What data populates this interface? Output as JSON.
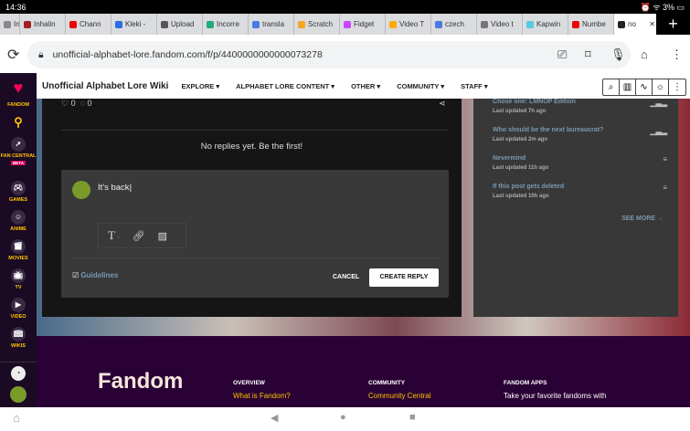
{
  "status": {
    "time": "14:36",
    "battery": "3%"
  },
  "tabs": [
    {
      "label": "Inc",
      "color": "#888"
    },
    {
      "label": "Inhalin",
      "color": "#a02020"
    },
    {
      "label": "Chann",
      "color": "#e00"
    },
    {
      "label": "Kleki -",
      "color": "#2a6de0"
    },
    {
      "label": "Upload",
      "color": "#555"
    },
    {
      "label": "Incorre",
      "color": "#2a7"
    },
    {
      "label": "transla",
      "color": "#4a7ae0"
    },
    {
      "label": "Scratch",
      "color": "#f5a623"
    },
    {
      "label": "Fidget",
      "color": "#c4f"
    },
    {
      "label": "Video T",
      "color": "#fa0"
    },
    {
      "label": "czech",
      "color": "#4a7ae0"
    },
    {
      "label": "Video t",
      "color": "#777"
    },
    {
      "label": "Kapwin",
      "color": "#5cd"
    },
    {
      "label": "Numbe",
      "color": "#e00"
    },
    {
      "label": "no",
      "color": "#222",
      "active": true
    }
  ],
  "browser": {
    "url": "unofficial-alphabet-lore.fandom.com/f/p/4400000000000073278",
    "new_tab": "+"
  },
  "wiki": {
    "title": "Unofficial Alphabet Lore Wiki",
    "nav": [
      "EXPLORE ▾",
      "ALPHABET LORE CONTENT ▾",
      "OTHER ▾",
      "COMMUNITY ▾",
      "STAFF ▾"
    ]
  },
  "sidebar": {
    "fandom": "FANDOM",
    "fan_central": "FAN CENTRAL",
    "beta": "BETA",
    "items": [
      "GAMES",
      "ANIME",
      "MOVIES",
      "TV",
      "VIDEO",
      "WIKIS"
    ]
  },
  "post": {
    "likes": "0",
    "comments": "0",
    "no_replies": "No replies yet. Be the first!",
    "reply_text": "It's back",
    "guidelines": "Guidelines",
    "cancel": "CANCEL",
    "create_reply": "CREATE REPLY"
  },
  "related": {
    "items": [
      {
        "title": "Chose one: LMNOP Edition",
        "updated": "Last updated 7h ago",
        "icon": "poll"
      },
      {
        "title": "Who should be the next bureaucrat?",
        "updated": "Last updated 2m ago",
        "icon": "poll"
      },
      {
        "title": "Nevermind",
        "updated": "Last updated 11h ago",
        "icon": "text"
      },
      {
        "title": "If this post gets deleted",
        "updated": "Last updated 10h ago",
        "icon": "text"
      }
    ],
    "see_more": "SEE MORE →"
  },
  "footer": {
    "logo": "Fandom",
    "cols": [
      {
        "head": "OVERVIEW",
        "link": "What is Fandom?"
      },
      {
        "head": "COMMUNITY",
        "link": "Community Central"
      },
      {
        "head": "FANDOM APPS",
        "link": "Take your favorite fandoms with"
      }
    ]
  }
}
